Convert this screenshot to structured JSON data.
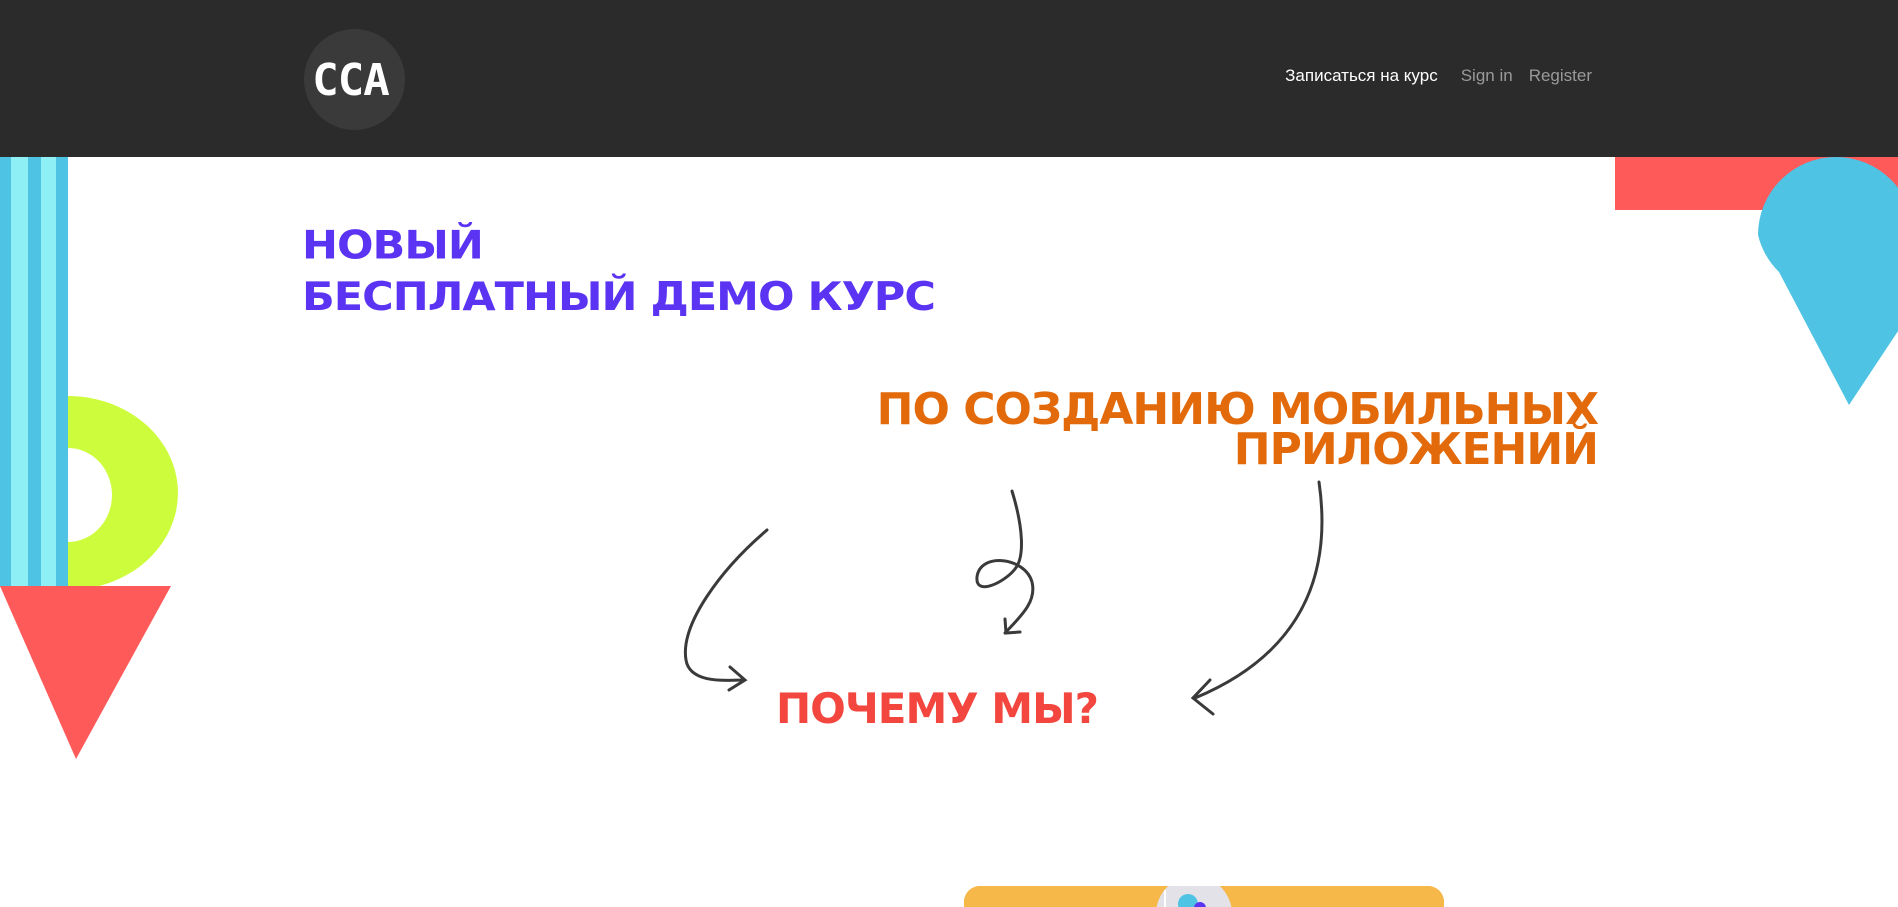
{
  "header": {
    "logo_text": "CCA",
    "nav": {
      "enroll_label": "Записаться на курс",
      "signin_label": "Sign in",
      "register_label": "Register"
    }
  },
  "hero": {
    "line1": "НОВЫЙ",
    "line2": "БЕСПЛАТНЫЙ ДЕМО КУРС",
    "subtitle_line1": "ПО СОЗДАНИЮ МОБИЛЬНЫХ",
    "subtitle_line2": "ПРИЛОЖЕНИЙ",
    "why": "ПОЧЕМУ МЫ?"
  },
  "colors": {
    "header_bg": "#2b2b2b",
    "purple": "#5a34f2",
    "orange": "#e36a0b",
    "red": "#f2463f",
    "cyan": "#4fc3e3",
    "light_cyan": "#8ef0f4",
    "lime": "#cdfc3c",
    "coral": "#ff5a5a",
    "card_yellow": "#f7b84a"
  },
  "icons": {
    "arrows": [
      "curved-arrow-left-icon",
      "loop-arrow-icon",
      "curved-arrow-right-icon"
    ]
  }
}
